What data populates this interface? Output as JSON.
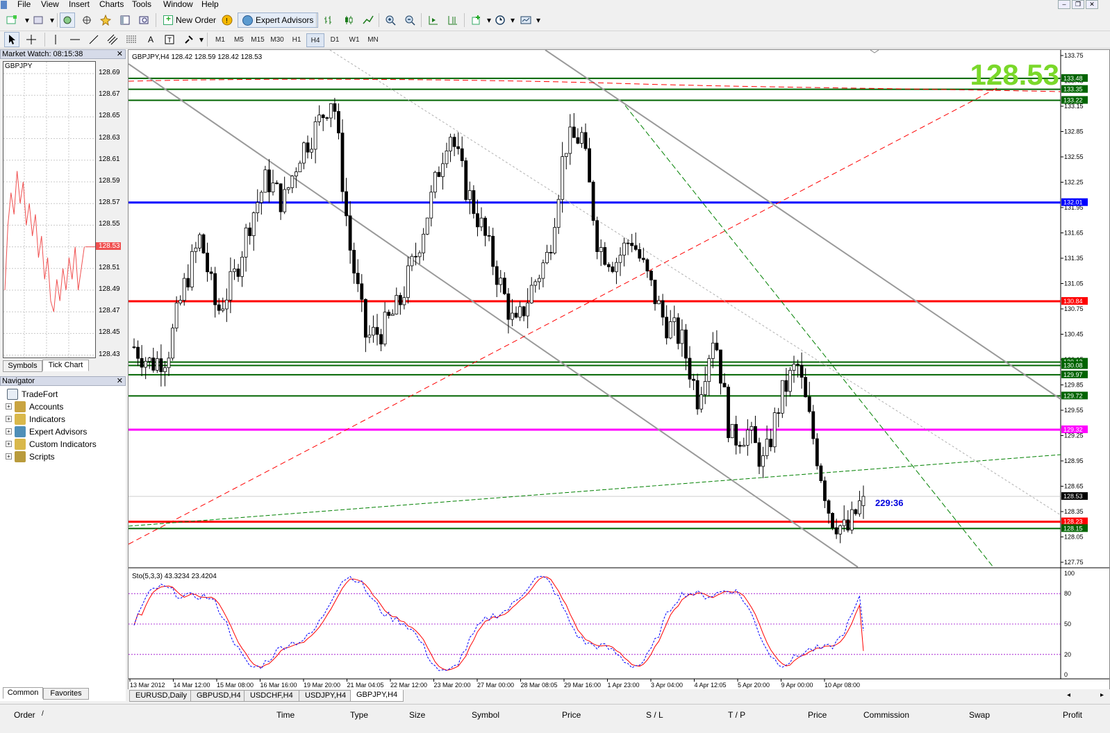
{
  "menu": [
    "File",
    "View",
    "Insert",
    "Charts",
    "Tools",
    "Window",
    "Help"
  ],
  "toolbar": {
    "new_order": "New Order",
    "expert_advisors": "Expert Advisors",
    "timeframes": [
      "M1",
      "M5",
      "M15",
      "M30",
      "H1",
      "H4",
      "D1",
      "W1",
      "MN"
    ],
    "active_timeframe": "H4"
  },
  "market_watch": {
    "title": "Market Watch: 08:15:38",
    "symbol": "GBPJPY",
    "price_axis": [
      "128.69",
      "128.67",
      "128.65",
      "128.63",
      "128.61",
      "128.59",
      "128.57",
      "128.55",
      "128.53",
      "128.51",
      "128.49",
      "128.47",
      "128.45",
      "128.43"
    ],
    "current_price": "128.53",
    "tabs": [
      "Symbols",
      "Tick Chart"
    ],
    "active_tab": "Tick Chart"
  },
  "navigator": {
    "title": "Navigator",
    "root": "TradeFort",
    "items": [
      {
        "label": "Accounts",
        "icon": "accounts-icon",
        "color": "#c9a441"
      },
      {
        "label": "Indicators",
        "icon": "indicators-icon",
        "color": "#d9b84b"
      },
      {
        "label": "Expert Advisors",
        "icon": "expert-advisors-icon",
        "color": "#4f8fb8"
      },
      {
        "label": "Custom Indicators",
        "icon": "custom-indicators-icon",
        "color": "#d9b84b"
      },
      {
        "label": "Scripts",
        "icon": "scripts-icon",
        "color": "#b99b3c"
      }
    ],
    "tabs": [
      "Common",
      "Favorites"
    ],
    "active_tab": "Common"
  },
  "chart": {
    "header": "GBPJPY,H4  128.42 128.59 128.42 128.53",
    "big_price": "128.53",
    "big_price_color": "#7ad82a",
    "timer": "229:36",
    "price_axis": [
      "133.75",
      "133.45",
      "133.15",
      "132.85",
      "132.55",
      "132.25",
      "131.95",
      "131.65",
      "131.35",
      "131.05",
      "130.75",
      "130.45",
      "130.15",
      "129.85",
      "129.55",
      "129.25",
      "128.95",
      "128.65",
      "128.35",
      "128.05",
      "127.75"
    ],
    "level_labels": [
      {
        "text": "133.48",
        "color": "#006400"
      },
      {
        "text": "133.35",
        "color": "#006400"
      },
      {
        "text": "133.22",
        "color": "#006400"
      },
      {
        "text": "132.01",
        "color": "#0000ff"
      },
      {
        "text": "130.84",
        "color": "#ff0000"
      },
      {
        "text": "130.12",
        "color": "#006400"
      },
      {
        "text": "130.08",
        "color": "#006400"
      },
      {
        "text": "129.97",
        "color": "#006400"
      },
      {
        "text": "129.72",
        "color": "#006400"
      },
      {
        "text": "129.32",
        "color": "#ff00ff"
      },
      {
        "text": "128.53",
        "color": "#000000"
      },
      {
        "text": "128.23",
        "color": "#ff0000"
      },
      {
        "text": "128.15",
        "color": "#006400"
      }
    ],
    "time_axis": [
      "13 Mar 2012",
      "14 Mar 12:00",
      "15 Mar 08:00",
      "16 Mar 16:00",
      "19 Mar 20:00",
      "21 Mar 04:05",
      "22 Mar 12:00",
      "23 Mar 20:00",
      "27 Mar 00:00",
      "28 Mar 08:05",
      "29 Mar 16:00",
      "1 Apr 23:00",
      "3 Apr 04:00",
      "4 Apr 12:05",
      "5 Apr 20:00",
      "9 Apr 00:00",
      "10 Apr 08:00"
    ],
    "indicator_label": "Sto(5,3,3) 43.3234 23.4204",
    "indicator_axis": [
      "100",
      "80",
      "50",
      "20",
      "0"
    ]
  },
  "chart_tabs": [
    "EURUSD,Daily",
    "GBPUSD,H4",
    "USDCHF,H4",
    "USDJPY,H4",
    "GBPJPY,H4"
  ],
  "active_chart_tab": "GBPJPY,H4",
  "terminal_columns": [
    "Order",
    "/",
    "Time",
    "Type",
    "Size",
    "Symbol",
    "Price",
    "S / L",
    "T / P",
    "Price",
    "Commission",
    "Swap",
    "Profit"
  ],
  "chart_data": {
    "type": "candlestick",
    "symbol": "GBPJPY",
    "timeframe": "H4",
    "ylim": [
      127.7,
      133.8
    ],
    "x": [
      "13 Mar 2012",
      "14 Mar 12:00",
      "15 Mar 08:00",
      "16 Mar 16:00",
      "19 Mar 20:00",
      "21 Mar 04:05",
      "22 Mar 12:00",
      "23 Mar 20:00",
      "27 Mar 00:00",
      "28 Mar 08:05",
      "29 Mar 16:00",
      "1 Apr 23:00",
      "3 Apr 04:00",
      "4 Apr 12:05",
      "5 Apr 20:00",
      "9 Apr 00:00",
      "10 Apr 08:00"
    ],
    "close_path": [
      130.3,
      130.1,
      130.2,
      131.0,
      131.6,
      130.7,
      131.1,
      131.8,
      132.3,
      132.0,
      132.6,
      132.9,
      133.3,
      131.5,
      130.4,
      130.5,
      130.8,
      131.4,
      132.1,
      132.9,
      132.2,
      131.7,
      131.1,
      130.5,
      131.0,
      131.4,
      132.7,
      132.8,
      131.5,
      131.3,
      131.6,
      131.1,
      130.6,
      130.4,
      129.7,
      130.5,
      129.2,
      129.3,
      128.9,
      129.7,
      130.1,
      129.2,
      128.3,
      128.1,
      128.53
    ],
    "stochastic": {
      "k": [
        43.32
      ],
      "d": [
        23.42
      ],
      "levels": [
        80,
        50,
        20
      ]
    }
  }
}
